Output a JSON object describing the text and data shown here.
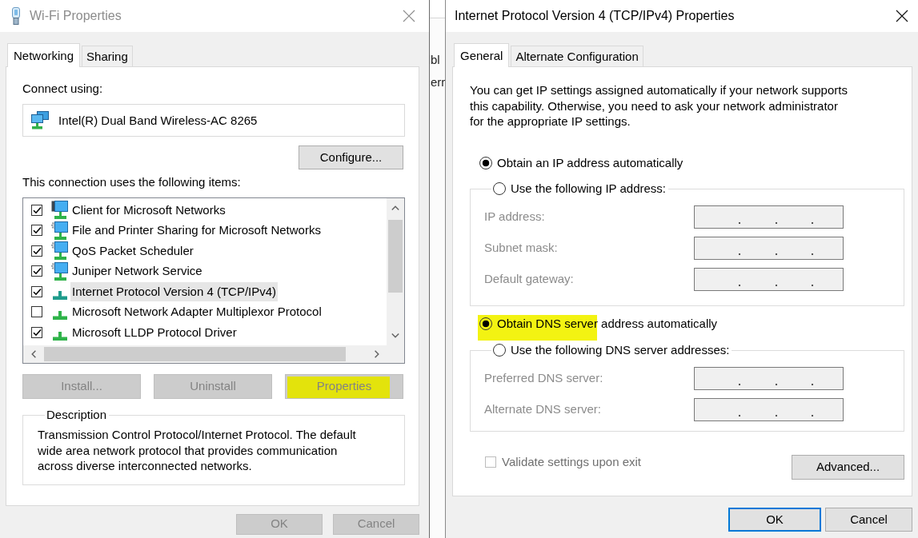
{
  "wifi_properties": {
    "title": "Wi-Fi Properties",
    "active": false,
    "tabs": [
      {
        "label": "Networking",
        "selected": true
      },
      {
        "label": "Sharing",
        "selected": false
      }
    ],
    "connect_using_label": "Connect using:",
    "adapter": "Intel(R) Dual Band Wireless-AC 8265",
    "configure_button": "Configure...",
    "items_label": "This connection uses the following items:",
    "items": [
      {
        "label": "Client for Microsoft Networks",
        "kind": "client",
        "checked": true,
        "selected": false
      },
      {
        "label": "File and Printer Sharing for Microsoft Networks",
        "kind": "service",
        "checked": true,
        "selected": false
      },
      {
        "label": "QoS Packet Scheduler",
        "kind": "service",
        "checked": true,
        "selected": false
      },
      {
        "label": "Juniper Network Service",
        "kind": "service",
        "checked": true,
        "selected": false
      },
      {
        "label": "Internet Protocol Version 4 (TCP/IPv4)",
        "kind": "protocol",
        "checked": true,
        "selected": true
      },
      {
        "label": "Microsoft Network Adapter Multiplexor Protocol",
        "kind": "protocol",
        "checked": false,
        "selected": false
      },
      {
        "label": "Microsoft LLDP Protocol Driver",
        "kind": "protocol",
        "checked": true,
        "selected": false
      }
    ],
    "item_buttons": [
      {
        "label": "Install...",
        "disabled": true,
        "highlighted": false
      },
      {
        "label": "Uninstall",
        "disabled": true,
        "highlighted": false
      },
      {
        "label": "Properties",
        "disabled": true,
        "highlighted": true
      }
    ],
    "description": {
      "title": "Description",
      "text": "Transmission Control Protocol/Internet Protocol. The default wide area network protocol that provides communication across diverse interconnected networks."
    },
    "dialog_buttons": [
      {
        "label": "OK",
        "disabled": true
      },
      {
        "label": "Cancel",
        "disabled": true
      }
    ]
  },
  "background_window": {
    "fragments": [
      "bl",
      "err"
    ]
  },
  "ipv4_properties": {
    "title": "Internet Protocol Version 4 (TCP/IPv4) Properties",
    "active": true,
    "tabs": [
      {
        "label": "General",
        "selected": true
      },
      {
        "label": "Alternate Configuration",
        "selected": false
      }
    ],
    "intro": "You can get IP settings assigned automatically if your network supports this capability. Otherwise, you need to ask your network administrator for the appropriate IP settings.",
    "ip_settings": {
      "options": [
        {
          "label": "Obtain an IP address automatically",
          "selected": true,
          "highlighted": false
        },
        {
          "label": "Use the following IP address:",
          "selected": false,
          "highlighted": false
        }
      ],
      "fields": [
        {
          "label": "IP address:"
        },
        {
          "label": "Subnet mask:"
        },
        {
          "label": "Default gateway:"
        }
      ]
    },
    "dns_settings": {
      "options": [
        {
          "label": "Obtain DNS server address automatically",
          "selected": true,
          "highlighted": true
        },
        {
          "label": "Use the following DNS server addresses:",
          "selected": false,
          "highlighted": false
        }
      ],
      "fields": [
        {
          "label": "Preferred DNS server:"
        },
        {
          "label": "Alternate DNS server:"
        }
      ]
    },
    "validate": {
      "label": "Validate settings upon exit",
      "checked": false,
      "disabled": true
    },
    "advanced_button": "Advanced...",
    "dialog_buttons": [
      {
        "label": "OK",
        "focused": true
      },
      {
        "label": "Cancel",
        "focused": false
      }
    ]
  }
}
